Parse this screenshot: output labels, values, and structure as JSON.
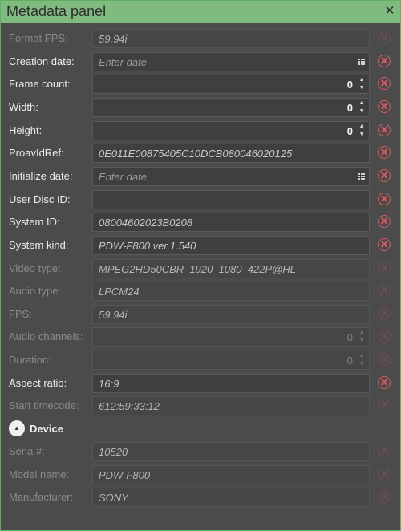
{
  "window": {
    "title": "Metadata panel",
    "close_icon": "close-icon"
  },
  "colors": {
    "title_bar": "#7fba7f",
    "border": "#5fb15f",
    "clear_icon": "#e25a5a"
  },
  "fields": [
    {
      "label": "Format FPS:",
      "value": "59.94i",
      "enabled": false,
      "kind": "text"
    },
    {
      "label": "Creation date:",
      "value": "",
      "placeholder": "Enter date",
      "enabled": true,
      "kind": "date"
    },
    {
      "label": "Frame count:",
      "value": "0",
      "enabled": true,
      "kind": "number"
    },
    {
      "label": "Width:",
      "value": "0",
      "enabled": true,
      "kind": "number"
    },
    {
      "label": "Height:",
      "value": "0",
      "enabled": true,
      "kind": "number"
    },
    {
      "label": "ProavIdRef:",
      "value": "0E011E00875405C10DCB080046020125",
      "enabled": true,
      "kind": "text"
    },
    {
      "label": "Initialize date:",
      "value": "",
      "placeholder": "Enter date",
      "enabled": true,
      "kind": "date"
    },
    {
      "label": "User Disc ID:",
      "value": "",
      "enabled": true,
      "kind": "text"
    },
    {
      "label": "System ID:",
      "value": "08004602023B0208",
      "enabled": true,
      "kind": "text"
    },
    {
      "label": "System kind:",
      "value": "PDW-F800 ver.1.540",
      "enabled": true,
      "kind": "text"
    },
    {
      "label": "Video type:",
      "value": "MPEG2HD50CBR_1920_1080_422P@HL",
      "enabled": false,
      "kind": "text"
    },
    {
      "label": "Audio type:",
      "value": "LPCM24",
      "enabled": false,
      "kind": "text"
    },
    {
      "label": "FPS:",
      "value": "59.94i",
      "enabled": false,
      "kind": "text"
    },
    {
      "label": "Audio channels:",
      "value": "0",
      "enabled": false,
      "kind": "number"
    },
    {
      "label": "Duration:",
      "value": "0",
      "enabled": false,
      "kind": "number"
    },
    {
      "label": "Aspect ratio:",
      "value": "16:9",
      "enabled": true,
      "kind": "text"
    },
    {
      "label": "Start timecode:",
      "value": "612:59:33:12",
      "enabled": false,
      "kind": "text"
    }
  ],
  "device": {
    "title": "Device",
    "toggle_icon": "collapse-icon",
    "fields": [
      {
        "label": "Seria #:",
        "value": "10520",
        "enabled": false,
        "kind": "text"
      },
      {
        "label": "Model name:",
        "value": "PDW-F800",
        "enabled": false,
        "kind": "text"
      },
      {
        "label": "Manufacturer:",
        "value": "SONY",
        "enabled": false,
        "kind": "text"
      }
    ]
  }
}
